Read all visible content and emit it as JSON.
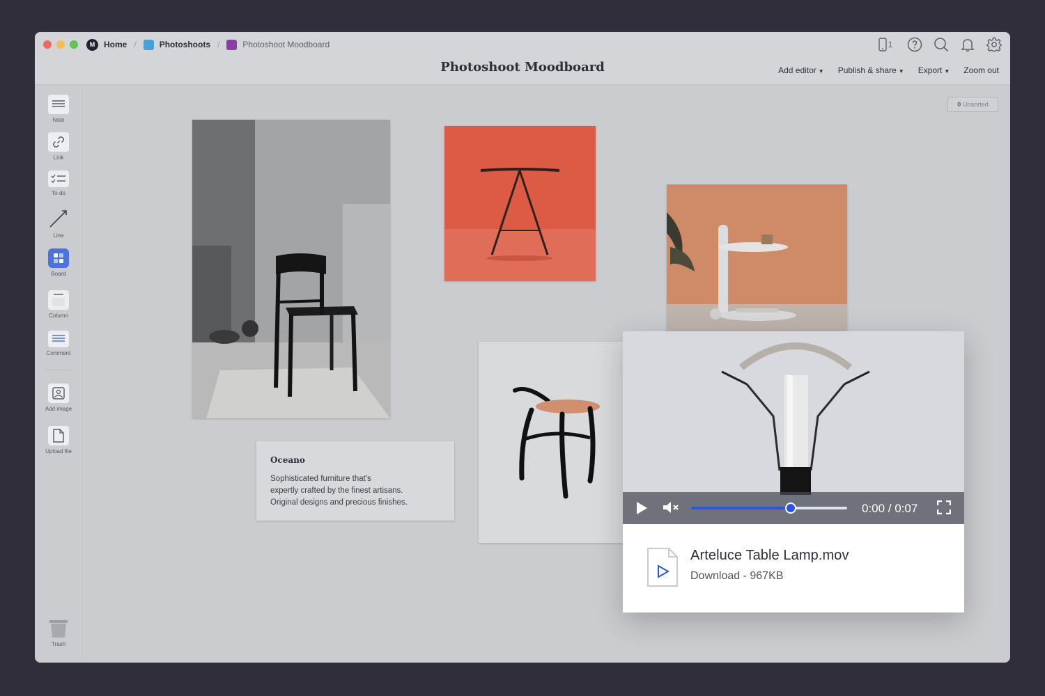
{
  "breadcrumb": {
    "home_label": "Home",
    "logo_text": "M",
    "items": [
      {
        "label": "Photoshoots",
        "color": "#43a2e0"
      },
      {
        "label": "Photoshoot Moodboard",
        "color": "#8a3ea6"
      }
    ],
    "separator": "/"
  },
  "header": {
    "title": "Photoshoot Moodboard",
    "device_count": "1"
  },
  "menu": {
    "add_editor": "Add editor",
    "publish_share": "Publish & share",
    "export": "Export",
    "zoom_out": "Zoom out"
  },
  "sidebar": {
    "tools": [
      {
        "label": "Note",
        "icon": "note-icon"
      },
      {
        "label": "Link",
        "icon": "link-icon"
      },
      {
        "label": "To-do",
        "icon": "todo-icon"
      },
      {
        "label": "Line",
        "icon": "line-icon"
      },
      {
        "label": "Board",
        "icon": "board-icon"
      },
      {
        "label": "Column",
        "icon": "column-icon"
      },
      {
        "label": "Comment",
        "icon": "comment-icon"
      },
      {
        "label": "Add image",
        "icon": "add-image-icon"
      },
      {
        "label": "Upload file",
        "icon": "upload-file-icon"
      }
    ],
    "trash_label": "Trash"
  },
  "canvas": {
    "unsorted_count": "0",
    "unsorted_label": "Unsorted",
    "note": {
      "title": "Oceano",
      "body": "Sophisticated furniture that's\nexpertly crafted by the finest artisans.\nOriginal designs and precious finishes."
    },
    "video": {
      "time": "0:00 / 0:07",
      "progress_fraction": 0.64,
      "file_name": "Arteluce Table Lamp.mov",
      "file_meta": "Download - 967KB"
    }
  },
  "colors": {
    "accent": "#2a56e8",
    "board_tool": "#4b73e0",
    "red_photo": "#dd5a44",
    "terracotta_photo": "#cf8a67"
  }
}
